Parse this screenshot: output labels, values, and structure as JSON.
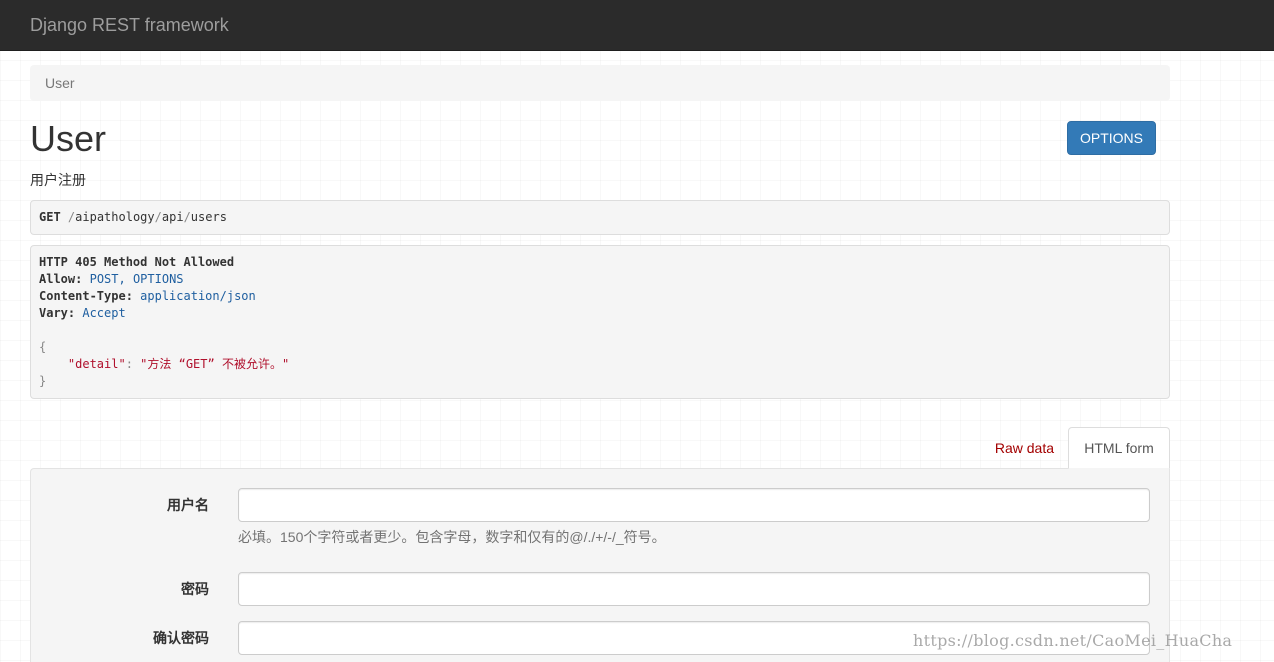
{
  "navbar": {
    "brand": "Django REST framework"
  },
  "breadcrumb": {
    "items": [
      "User"
    ]
  },
  "page": {
    "title": "User",
    "description": "用户注册",
    "options_label": "OPTIONS"
  },
  "request": {
    "method": "GET",
    "path_parts": [
      "/",
      "aipathology",
      "/",
      "api",
      "/",
      "users"
    ]
  },
  "response": {
    "status": "HTTP 405 Method Not Allowed",
    "headers": [
      {
        "key": "Allow:",
        "value": "POST, OPTIONS"
      },
      {
        "key": "Content-Type:",
        "value": "application/json"
      },
      {
        "key": "Vary:",
        "value": "Accept"
      }
    ],
    "body_open": "{",
    "body_key": "\"detail\"",
    "body_sep": ": ",
    "body_value": "\"方法 “GET” 不被允许。\"",
    "body_close": "}"
  },
  "tabs": {
    "raw": "Raw data",
    "html": "HTML form",
    "active": "html"
  },
  "form": {
    "fields": [
      {
        "label": "用户名",
        "value": "",
        "help": "必填。150个字符或者更少。包含字母，数字和仅有的@/./+/-/_符号。"
      },
      {
        "label": "密码",
        "value": ""
      },
      {
        "label": "确认密码",
        "value": ""
      }
    ]
  },
  "watermark": "https://blog.csdn.net/CaoMei_HuaCha",
  "colors": {
    "navbar_bg": "#2b2b2b",
    "primary_button": "#337ab7",
    "tab_link": "#a30000",
    "header_value": "#1f5fa0",
    "json_string": "#b0102c"
  }
}
